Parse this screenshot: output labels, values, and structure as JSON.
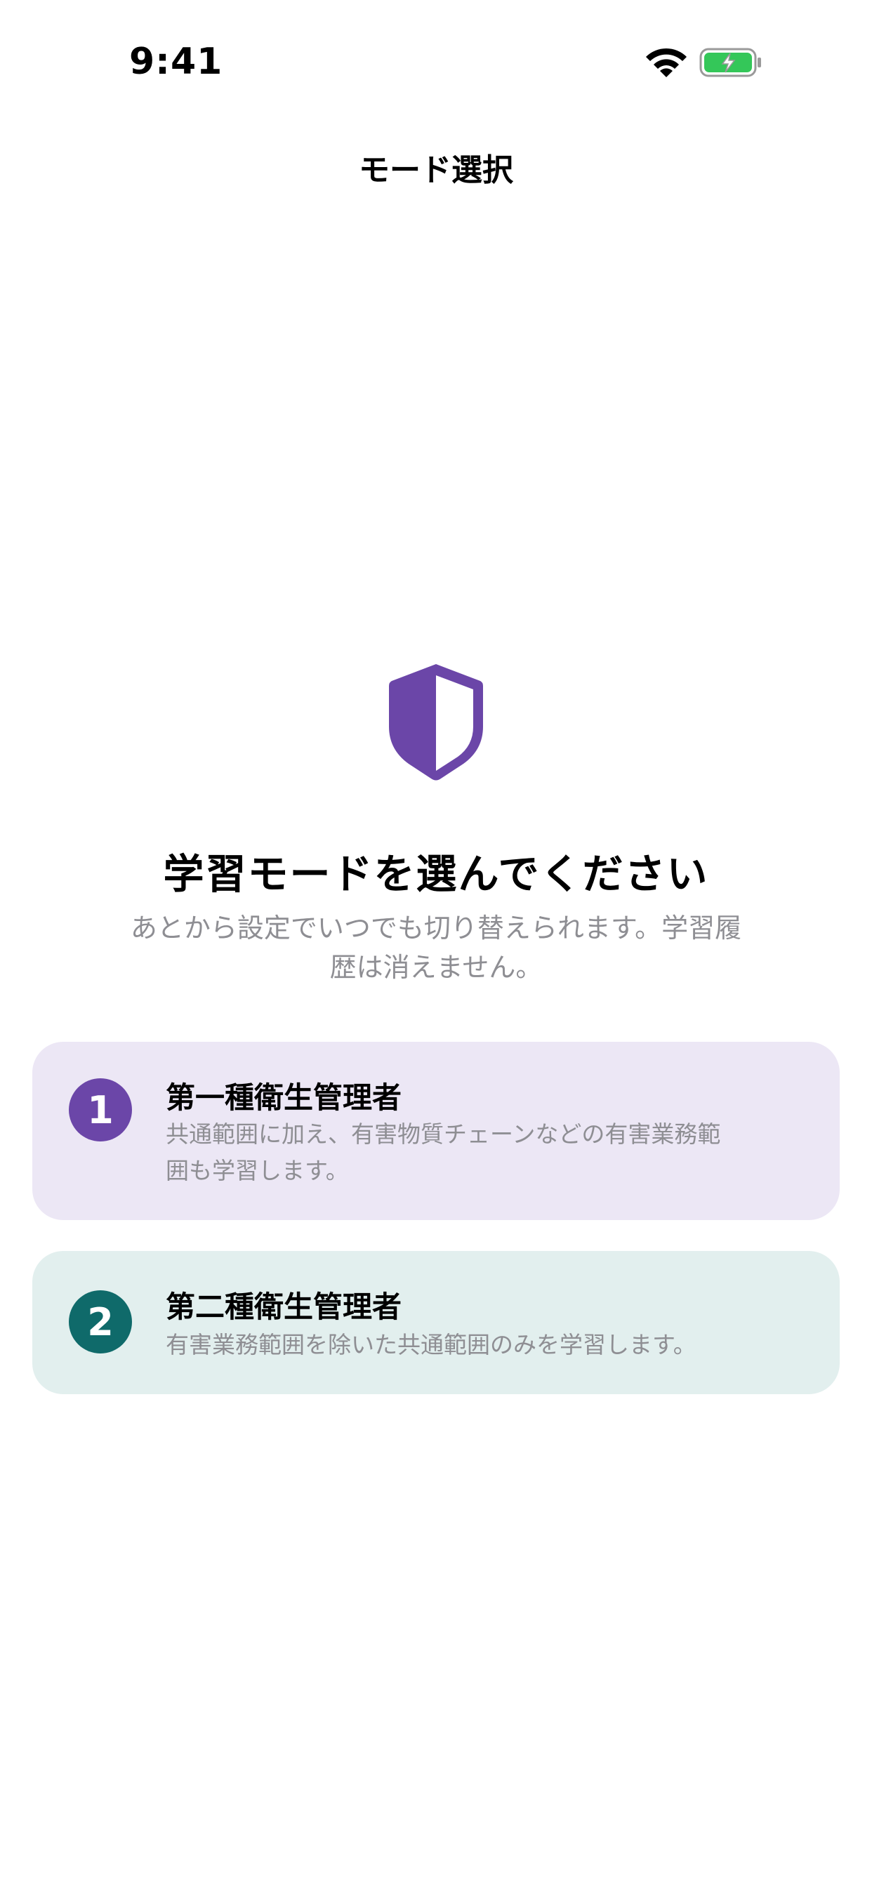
{
  "status_bar": {
    "time": "9:41",
    "icons": [
      "wifi-icon",
      "battery-charging-icon"
    ],
    "battery_color": "#34c759"
  },
  "nav": {
    "title": "モード選択"
  },
  "hero": {
    "icon": "shield-icon",
    "color": "#6b46a8"
  },
  "headline": "学習モードを選んでください",
  "subtext": "あとから設定でいつでも切り替えられます。学習履歴は消えません。",
  "options": [
    {
      "number": "1",
      "title": "第一種衛生管理者",
      "description": "共通範囲に加え、有害物質チェーンなどの有害業務範囲も学習します。",
      "accent": "#6b46a8",
      "background": "#ece7f5"
    },
    {
      "number": "2",
      "title": "第二種衛生管理者",
      "description": "有害業務範囲を除いた共通範囲のみを学習します。",
      "accent": "#0f6a6a",
      "background": "#e2efee"
    }
  ]
}
